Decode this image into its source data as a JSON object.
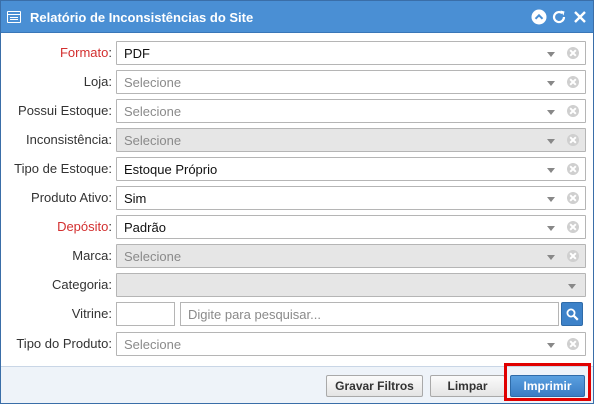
{
  "window": {
    "title": "Relatório de Inconsistências do Site"
  },
  "fields": [
    {
      "label": "Formato",
      "value": "PDF",
      "placeholder": "",
      "required": true,
      "disabled": false
    },
    {
      "label": "Loja",
      "value": "",
      "placeholder": "Selecione",
      "required": false,
      "disabled": false
    },
    {
      "label": "Possui Estoque",
      "value": "",
      "placeholder": "Selecione",
      "required": false,
      "disabled": false
    },
    {
      "label": "Inconsistência",
      "value": "",
      "placeholder": "Selecione",
      "required": false,
      "disabled": true
    },
    {
      "label": "Tipo de Estoque",
      "value": "Estoque Próprio",
      "placeholder": "",
      "required": false,
      "disabled": false
    },
    {
      "label": "Produto Ativo",
      "value": "Sim",
      "placeholder": "",
      "required": false,
      "disabled": false
    },
    {
      "label": "Depósito",
      "value": "Padrão",
      "placeholder": "",
      "required": true,
      "disabled": false
    },
    {
      "label": "Marca",
      "value": "",
      "placeholder": "Selecione",
      "required": false,
      "disabled": true
    },
    {
      "label": "Categoria",
      "value": "",
      "placeholder": "",
      "required": false,
      "disabled": true
    },
    {
      "label": "Vitrine",
      "value": "",
      "placeholder": "Digite para pesquisar...",
      "required": false,
      "disabled": false
    },
    {
      "label": "Tipo do Produto",
      "value": "",
      "placeholder": "Selecione",
      "required": false,
      "disabled": false
    }
  ],
  "buttons": {
    "filters": "Gravar Filtros",
    "clear": "Limpar",
    "print": "Imprimir"
  },
  "icons": {
    "titlebar": [
      "collapse-icon",
      "refresh-icon",
      "close-icon"
    ],
    "search": "magnifier-icon"
  },
  "colors": {
    "titlebar": "#4a8fd4",
    "required_label": "#d32f2f",
    "primary_button": "#3a7cc4",
    "highlight": "#e00000"
  }
}
